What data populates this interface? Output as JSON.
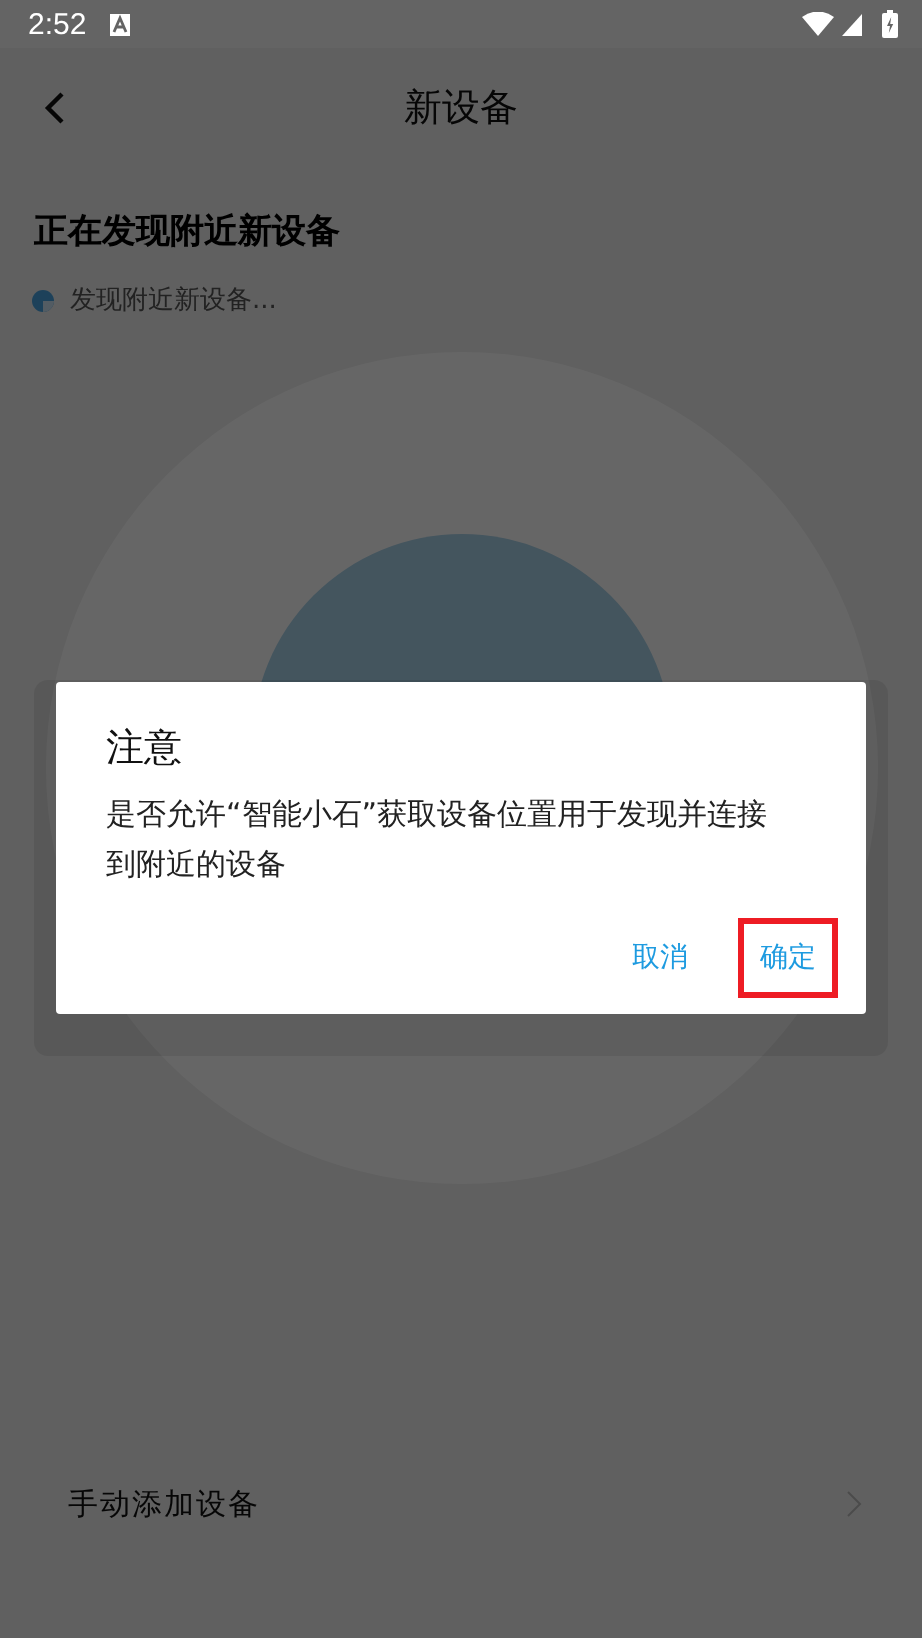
{
  "status_bar": {
    "time": "2:52"
  },
  "header": {
    "title": "新设备"
  },
  "section_title": "正在发现附近新设备",
  "scan_status": "发现附近新设备...",
  "manual_add": {
    "label": "手动添加设备"
  },
  "dialog": {
    "title": "注意",
    "message": "是否允许“智能小石”获取设备位置用于发现并连接到附近的设备",
    "buttons": [
      {
        "label": "取消",
        "highlighted": false
      },
      {
        "label": "确定",
        "highlighted": true
      }
    ]
  }
}
